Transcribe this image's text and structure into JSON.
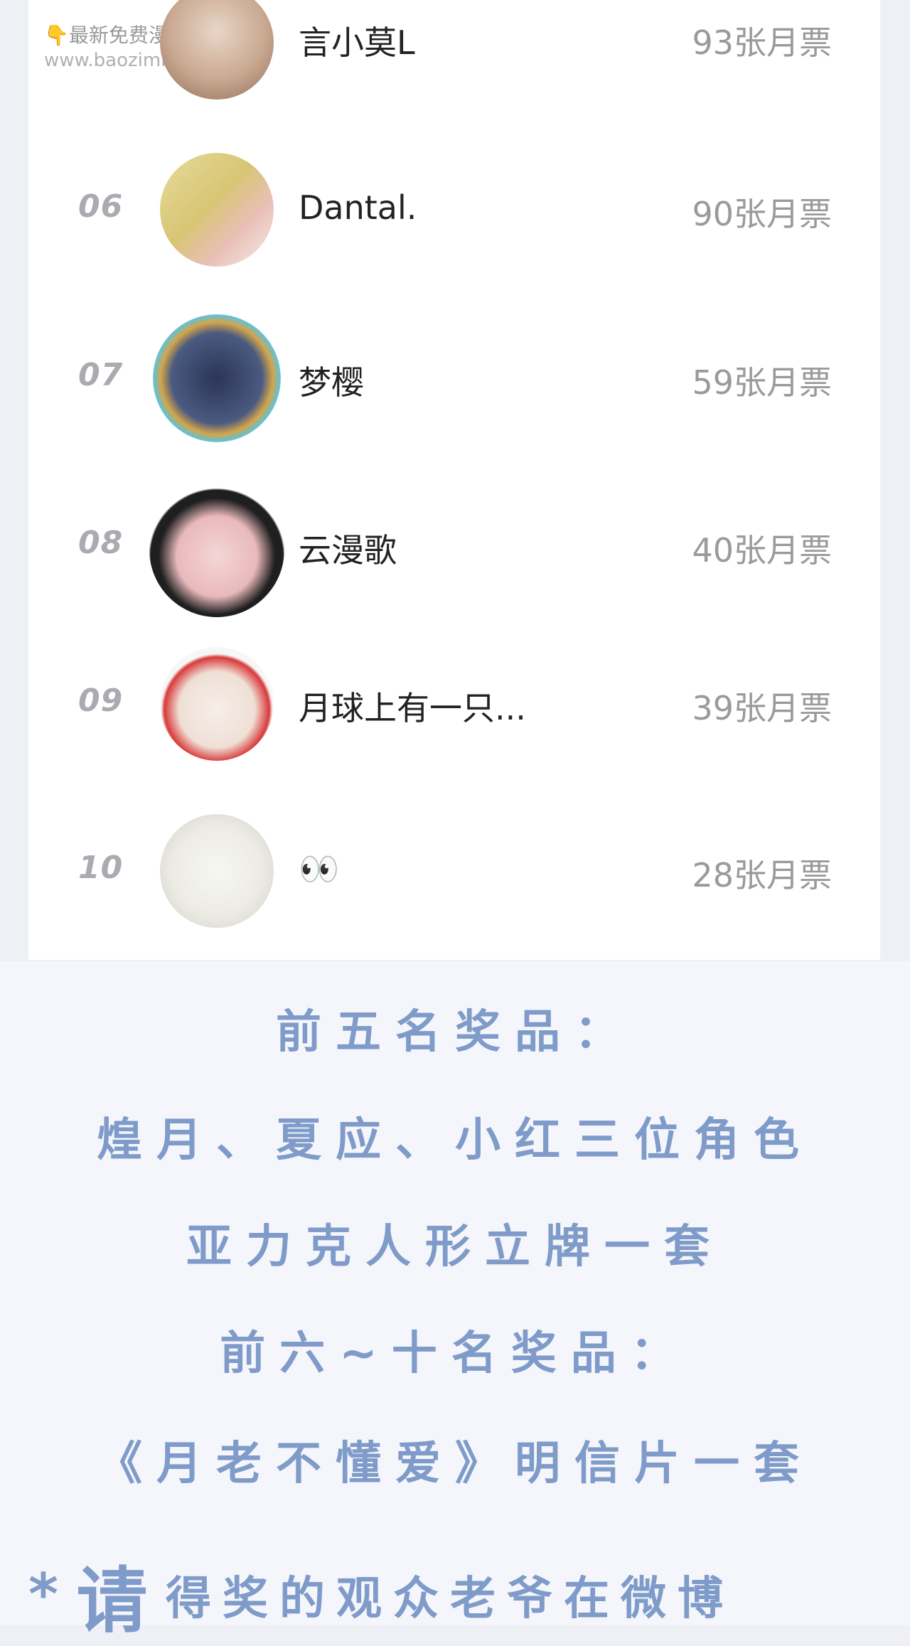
{
  "watermark": {
    "line1": "👇最新免费漫画👇",
    "line2": "www.baozimh.com"
  },
  "rows": [
    {
      "rank": "",
      "name": "言小莫L",
      "votes": "93张月票"
    },
    {
      "rank": "06",
      "name": "Dantal.",
      "votes": "90张月票"
    },
    {
      "rank": "07",
      "name": "梦樱",
      "votes": "59张月票"
    },
    {
      "rank": "08",
      "name": "云漫歌",
      "votes": "40张月票"
    },
    {
      "rank": "09",
      "name": "月球上有一只...",
      "votes": "39张月票"
    },
    {
      "rank": "10",
      "name": "👀",
      "votes": "28张月票"
    }
  ],
  "prizes": {
    "line1": "前五名奖品：",
    "line2": "煌月、夏应、小红三位角色",
    "line3": "亚力克人形立牌一套",
    "line4": "前六~十名奖品：",
    "line5": "《月老不懂爱》明信片一套",
    "final_star": "*",
    "final_big": "请",
    "final_rest": "得奖的观众老爷在微博"
  },
  "colors": {
    "accent": "#7f9bc9",
    "rank_gray": "#a9abb1",
    "votes_gray": "#9a9a9a"
  }
}
